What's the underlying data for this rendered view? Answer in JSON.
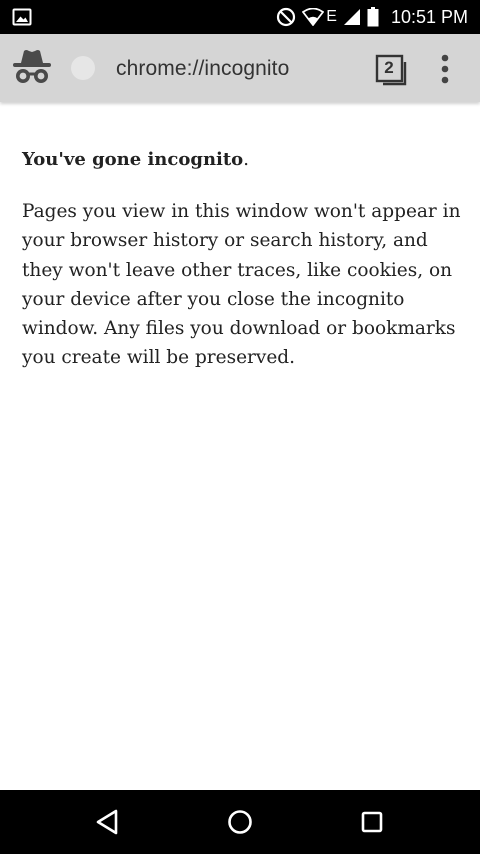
{
  "status_bar": {
    "time": "10:51 PM",
    "network_type": "E",
    "icons": [
      "image-notification-icon",
      "do-not-disturb-icon",
      "wifi-icon",
      "cell-signal-icon",
      "battery-icon"
    ]
  },
  "toolbar": {
    "url": "chrome://incognito",
    "tab_count": "2",
    "icons": [
      "incognito-icon",
      "tab-switcher-icon",
      "overflow-menu-icon"
    ]
  },
  "content": {
    "headline_bold": "You've gone incognito",
    "headline_period": ".",
    "body": "Pages you view in this window won't appear in your browser history or search history, and they won't leave other traces, like cookies, on your device after you close the incognito window. Any files you download or bookmarks you create will be preserved."
  },
  "nav_bar": {
    "icons": [
      "back-icon",
      "home-icon",
      "recents-icon"
    ]
  },
  "colors": {
    "toolbar_bg": "#d5d5d5",
    "status_bar_bg": "#000000",
    "nav_bar_bg": "#000000",
    "page_bg": "#ffffff",
    "text": "#222222"
  }
}
